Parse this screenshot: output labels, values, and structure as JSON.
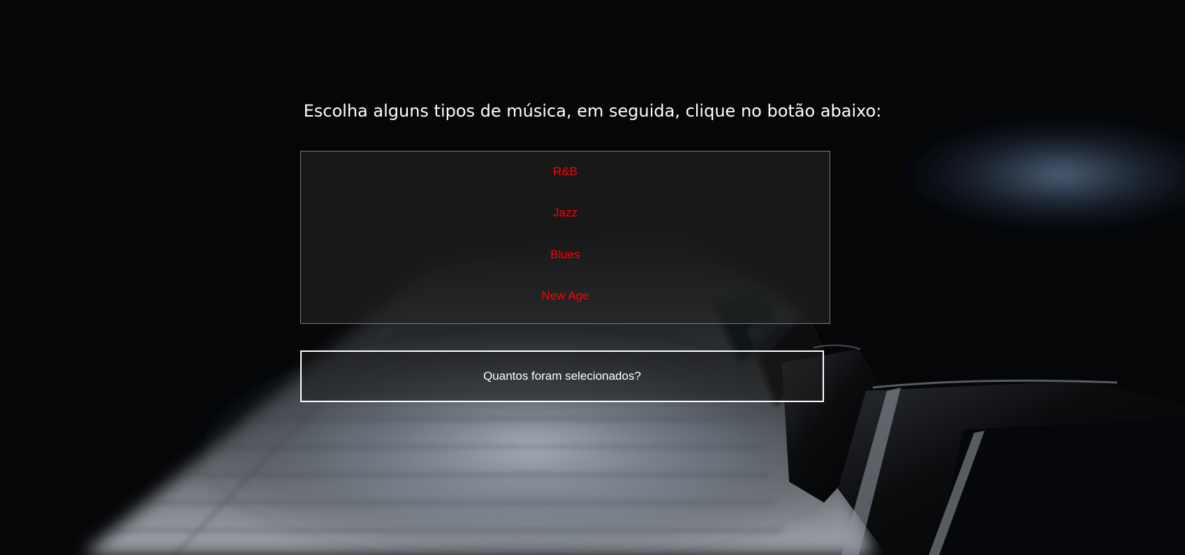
{
  "page": {
    "heading": "Escolha alguns tipos de música, em seguida, clique no botão abaixo:"
  },
  "music_options": [
    {
      "label": "R&B"
    },
    {
      "label": "Jazz"
    },
    {
      "label": "Blues"
    },
    {
      "label": "New Age"
    }
  ],
  "count_button": {
    "label": "Quantos foram selecionados?"
  },
  "colors": {
    "background": "#050608",
    "option_text": "#ff0000",
    "heading_text": "#ffffff",
    "button_border": "#ffffff"
  }
}
